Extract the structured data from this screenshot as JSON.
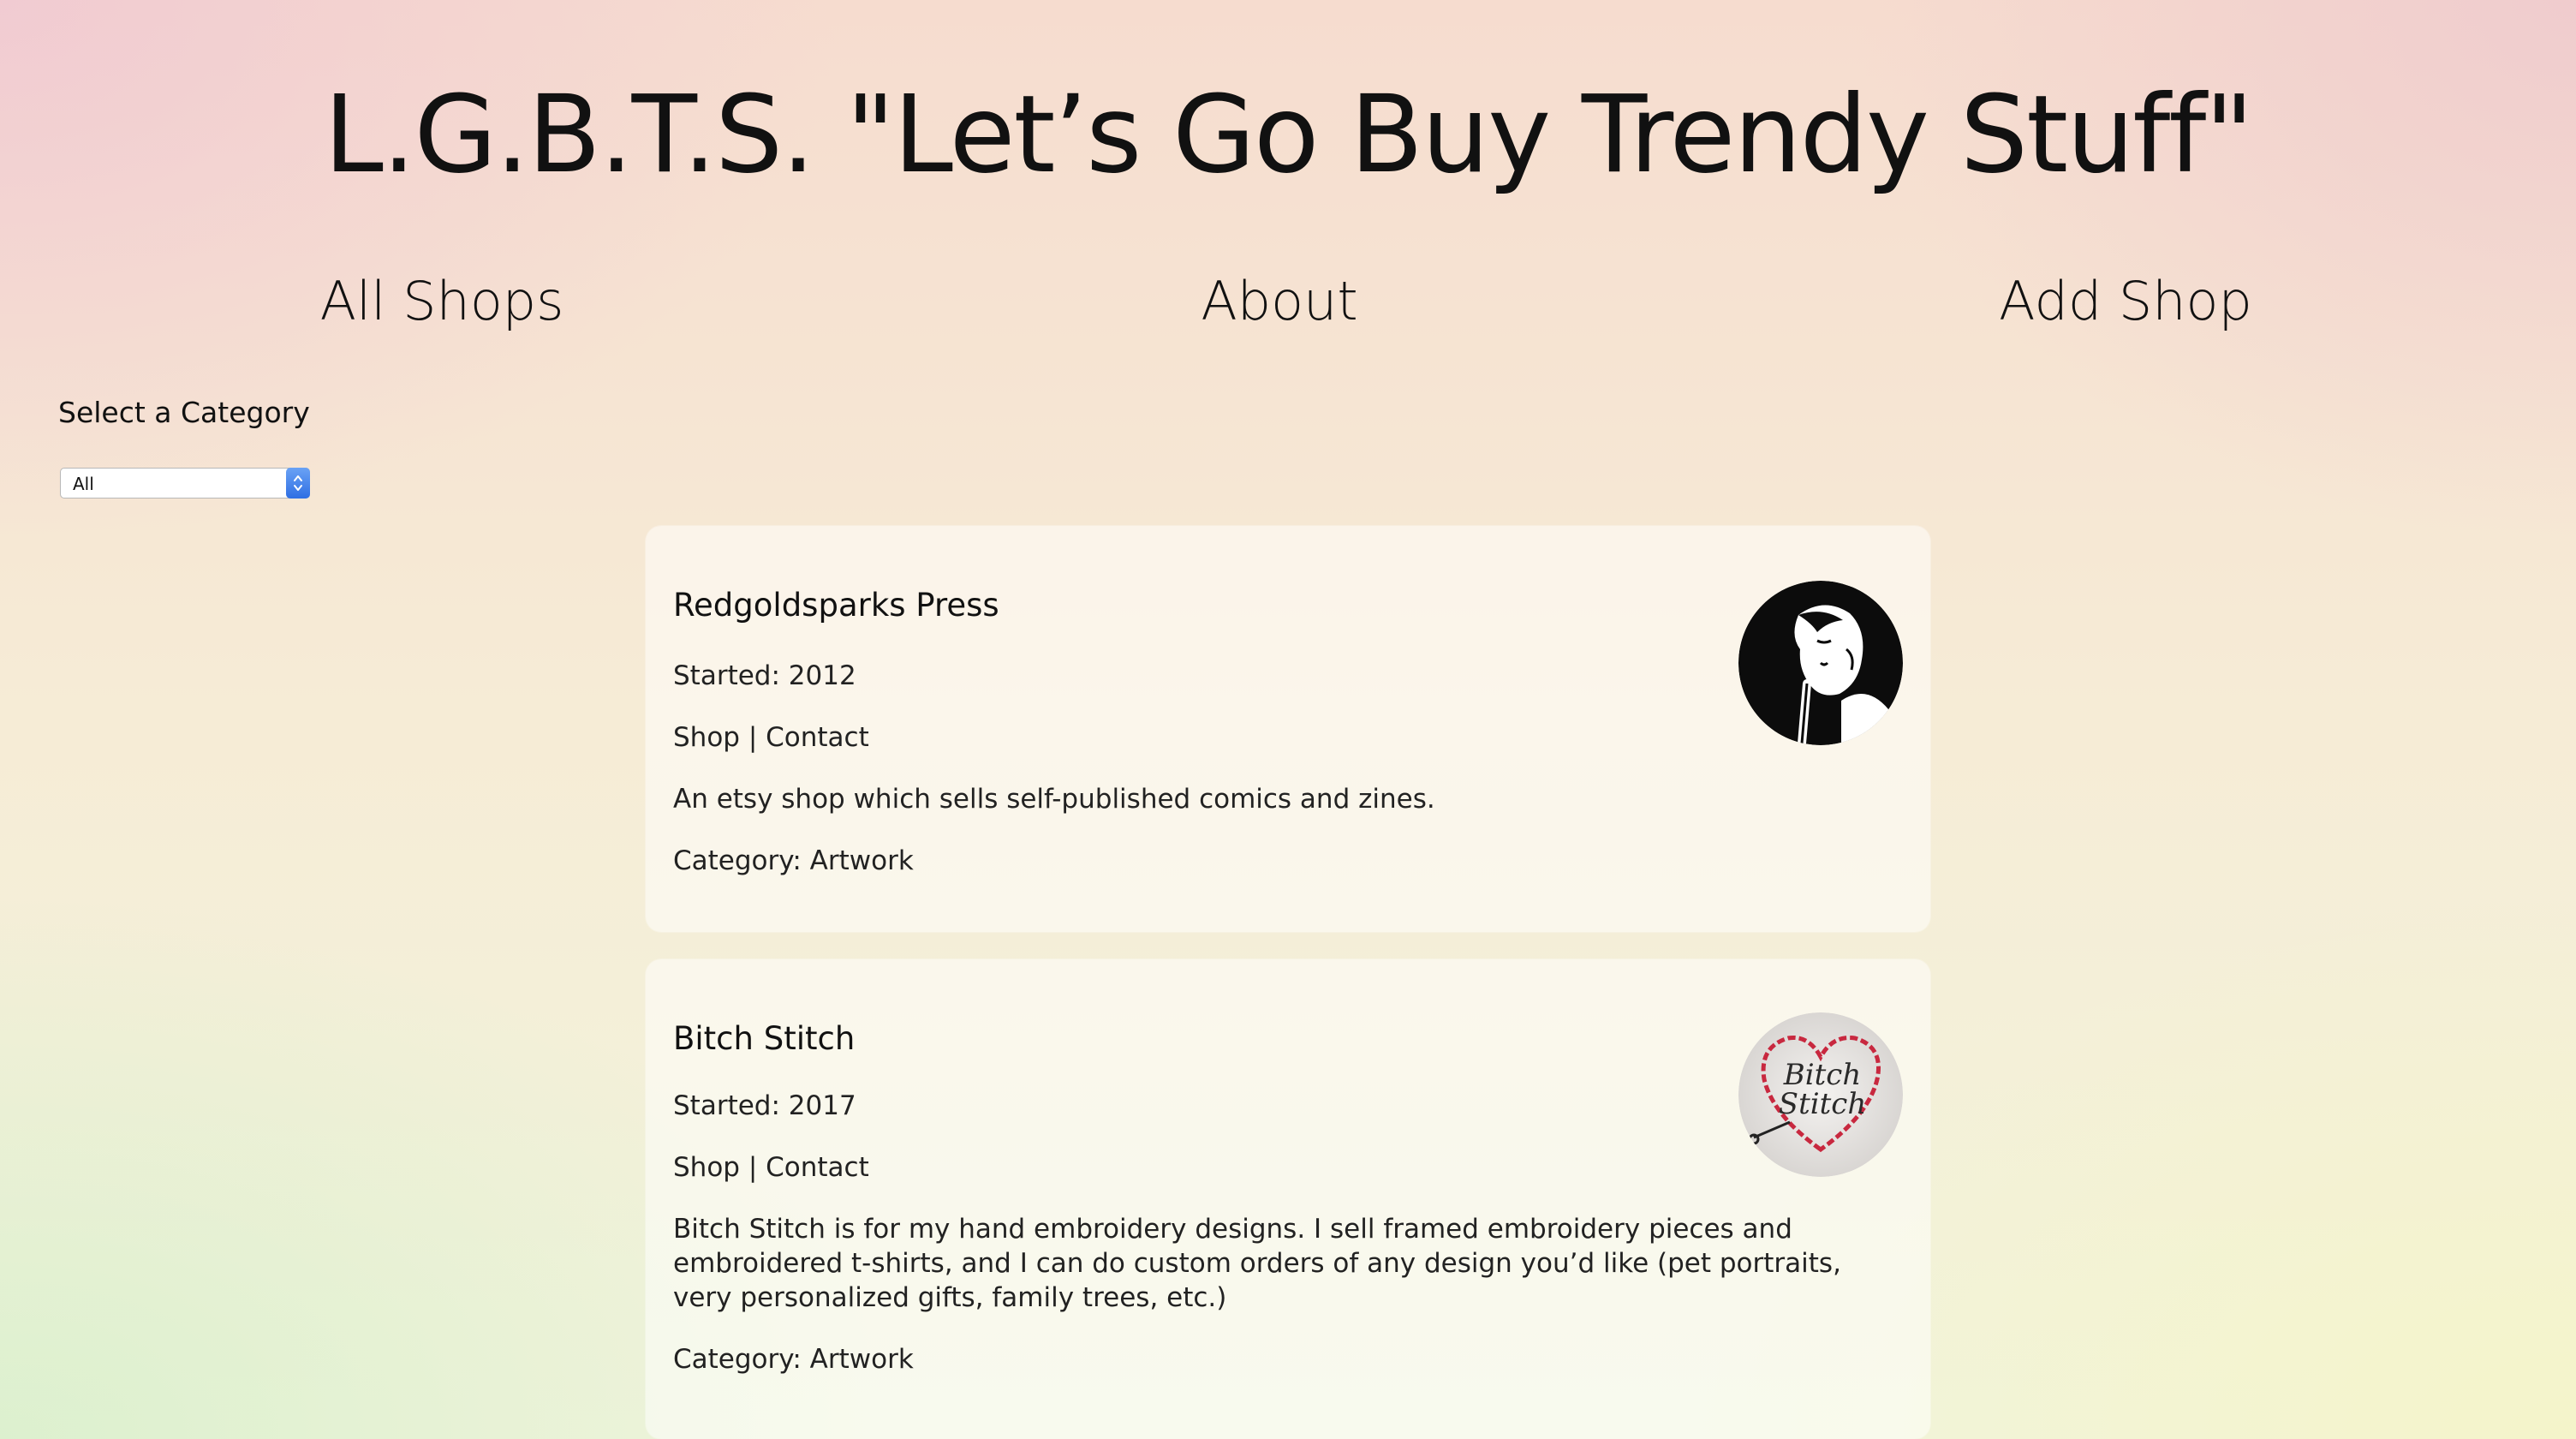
{
  "site": {
    "title": "L.G.B.T.S. \"Let’s Go Buy Trendy Stuff\""
  },
  "nav": {
    "all_shops": "All Shops",
    "about": "About",
    "add_shop": "Add Shop"
  },
  "filter": {
    "label": "Select a Category",
    "selected": "All"
  },
  "shops": [
    {
      "name": "Redgoldsparks Press",
      "started": "Started: 2012",
      "shop_link": "Shop",
      "separator": " | ",
      "contact_link": "Contact",
      "description": "An etsy shop which sells self-published comics and zines.",
      "category": "Category: Artwork",
      "logo_icon": "comic-portrait-icon"
    },
    {
      "name": "Bitch Stitch",
      "started": "Started: 2017",
      "shop_link": "Shop",
      "separator": " | ",
      "contact_link": "Contact",
      "description": "Bitch Stitch is for my hand embroidery designs. I sell framed embroidery pieces and embroidered t-shirts, and I can do custom orders of any design you’d like (pet portraits, very personalized gifts, family trees, etc.)",
      "category": "Category: Artwork",
      "logo_text": "Bitch Stitch",
      "logo_icon": "embroidered-heart-icon"
    }
  ],
  "colors": {
    "select_arrow": "#2f6fe3",
    "heart_stitch": "#c8283f"
  }
}
